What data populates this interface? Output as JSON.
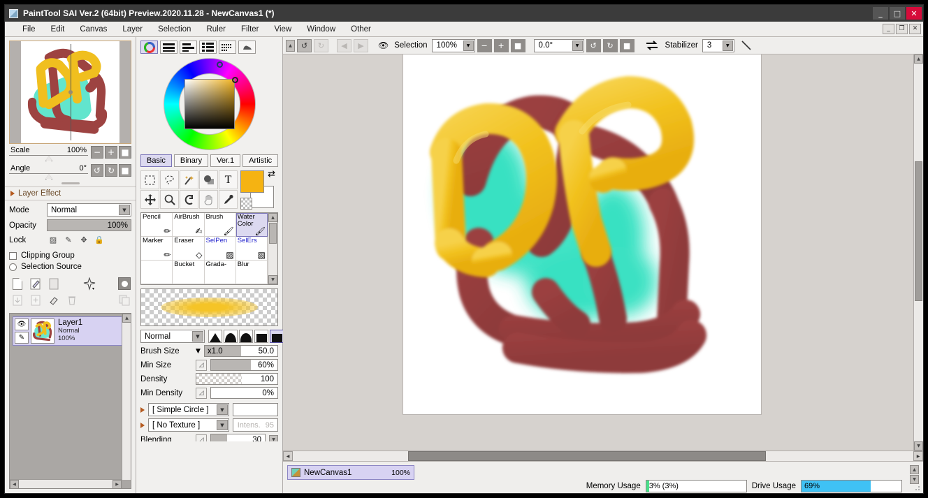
{
  "window": {
    "title": "PaintTool SAI Ver.2 (64bit) Preview.2020.11.28 - NewCanvas1 (*)",
    "app_icon": "app-icon",
    "minimize": "_",
    "maximize": "□",
    "close": "✕",
    "mdi_minimize": "_",
    "mdi_restore": "❐",
    "mdi_close": "✕"
  },
  "menu": {
    "items": [
      {
        "label": "File"
      },
      {
        "label": "Edit"
      },
      {
        "label": "Canvas"
      },
      {
        "label": "Layer"
      },
      {
        "label": "Selection"
      },
      {
        "label": "Ruler"
      },
      {
        "label": "Filter"
      },
      {
        "label": "View"
      },
      {
        "label": "Window"
      },
      {
        "label": "Other"
      }
    ]
  },
  "navigator": {
    "scale_label": "Scale",
    "scale_value": "100%",
    "angle_label": "Angle",
    "angle_value": "0°",
    "zoom_out": "−",
    "zoom_in": "+",
    "zoom_reset": "■",
    "rot_ccw": "↺",
    "rot_cw": "↻",
    "rot_reset": "■"
  },
  "layer_effect": {
    "label": "Layer Effect"
  },
  "layer_props": {
    "mode_label": "Mode",
    "mode_value": "Normal",
    "opacity_label": "Opacity",
    "opacity_value": "100%",
    "lock_label": "Lock",
    "lock_icons": [
      "lock-alpha-icon",
      "lock-pixel-icon",
      "lock-move-icon",
      "lock-all-icon"
    ],
    "clipping_group": "Clipping Group",
    "selection_source": "Selection Source"
  },
  "layer_toolbar": {
    "new_layer": "new-layer-icon",
    "new_linework": "new-linework-layer-icon",
    "new_folder": "new-folder-icon",
    "ruler": "ruler-icon",
    "mask": "layer-mask-icon",
    "merge_down": "merge-down-icon",
    "add": "add-icon",
    "clear": "clear-icon",
    "delete": "delete-icon",
    "duplicate": "duplicate-icon"
  },
  "layers": [
    {
      "name": "Layer1",
      "mode": "Normal",
      "opacity": "100%",
      "visible_icon": "eye-icon",
      "edit_icon": "pen-icon",
      "selected": true
    }
  ],
  "color_panel": {
    "mode_buttons": [
      {
        "name": "color-wheel-mode",
        "selected": true
      },
      {
        "name": "rgb-sliders-mode",
        "selected": false
      },
      {
        "name": "hsv-sliders-mode",
        "selected": false
      },
      {
        "name": "color-list-mode",
        "selected": false
      },
      {
        "name": "swatches-mode",
        "selected": false
      },
      {
        "name": "gradient-mode",
        "selected": false
      }
    ],
    "tabs": [
      {
        "label": "Basic",
        "selected": true
      },
      {
        "label": "Binary",
        "selected": false
      },
      {
        "label": "Ver.1",
        "selected": false
      },
      {
        "label": "Artistic",
        "selected": false
      }
    ],
    "foreground_color": "#f5b312",
    "background_color": "#ffffff",
    "swap_icon": "swap-colors-icon",
    "transparent_icon": "transparent-color-icon"
  },
  "tools": [
    {
      "name": "rect-select-tool"
    },
    {
      "name": "lasso-select-tool"
    },
    {
      "name": "magic-wand-tool"
    },
    {
      "name": "shape-tool"
    },
    {
      "name": "text-tool",
      "glyph": "T"
    },
    {
      "name": "move-tool"
    },
    {
      "name": "zoom-tool"
    },
    {
      "name": "rotate-tool"
    },
    {
      "name": "hand-tool"
    },
    {
      "name": "eyedropper-tool"
    }
  ],
  "brushes": [
    {
      "label": "Pencil",
      "icon": "pencil-icon",
      "selected": false,
      "blue": false
    },
    {
      "label": "AirBrush",
      "icon": "airbrush-icon",
      "selected": false,
      "blue": false
    },
    {
      "label": "Brush",
      "icon": "brush-icon",
      "selected": false,
      "blue": false
    },
    {
      "label": "Water Color",
      "icon": "watercolor-icon",
      "selected": true,
      "blue": false
    },
    {
      "label": "Marker",
      "icon": "marker-icon",
      "selected": false,
      "blue": false
    },
    {
      "label": "Eraser",
      "icon": "eraser-icon",
      "selected": false,
      "blue": false
    },
    {
      "label": "SelPen",
      "icon": "selpen-icon",
      "selected": false,
      "blue": true
    },
    {
      "label": "SelErs",
      "icon": "selers-icon",
      "selected": false,
      "blue": true
    },
    {
      "label": "",
      "icon": "",
      "selected": false,
      "blue": false
    },
    {
      "label": "Bucket",
      "icon": "bucket-icon",
      "selected": false,
      "blue": false
    },
    {
      "label": "Grada-",
      "icon": "gradation-icon",
      "selected": false,
      "blue": false
    },
    {
      "label": "Blur",
      "icon": "blur-icon",
      "selected": false,
      "blue": false
    }
  ],
  "brush_settings": {
    "blend_mode": "Normal",
    "shape_buttons": [
      "shape-sharp",
      "shape-soft",
      "shape-bell",
      "shape-flat",
      "shape-square-selected"
    ],
    "brush_size_label": "Brush Size",
    "brush_size_multiplier": "x1.0",
    "brush_size_value": "50.0",
    "min_size_label": "Min Size",
    "min_size_value": "60%",
    "density_label": "Density",
    "density_value": "100",
    "min_density_label": "Min Density",
    "min_density_value": "0%",
    "shape_preset": "[ Simple Circle ]",
    "texture_preset": "[ No Texture ]",
    "texture_intensity_label": "Intens.",
    "texture_intensity_value": "95",
    "blending_label": "Blending",
    "blending_value": "30"
  },
  "canvas_toolbar": {
    "undo": "undo-icon",
    "redo": "redo-icon",
    "prev_page": "prev-icon",
    "next_page": "next-icon",
    "selection_eye": "eye-icon",
    "selection_label": "Selection",
    "zoom_value": "100%",
    "zoom_out": "−",
    "zoom_in": "+",
    "zoom_reset": "■",
    "rotation_value": "0.0°",
    "rot_ccw": "↺",
    "rot_cw": "↻",
    "rot_reset": "■",
    "flip_icon": "flip-horizontal-icon",
    "stabilizer_label": "Stabilizer",
    "stabilizer_value": "3",
    "line_tool_icon": "line-stabilizer-icon"
  },
  "artwork": {
    "description": "DP lettering painted in golden yellow with dark red strokes and cyan glow",
    "yellow": "#f0bf1f",
    "dark_red": "#9d4341",
    "teal": "#2edcbc",
    "background": "#ffffff"
  },
  "statusbar": {
    "doc_tab_name": "NewCanvas1",
    "doc_tab_zoom": "100%",
    "memory_label": "Memory Usage",
    "memory_value": "3% (3%)",
    "memory_fill_color": "#49e08a",
    "memory_fill_pct": 3,
    "drive_label": "Drive Usage",
    "drive_value": "69%",
    "drive_fill_color": "#3fc2f5",
    "drive_fill_pct": 69
  }
}
